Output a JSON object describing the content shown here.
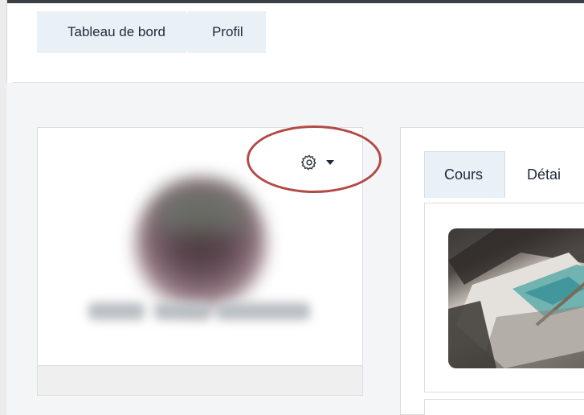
{
  "breadcrumb": {
    "items": [
      {
        "label": "Tableau de bord"
      },
      {
        "label": "Profil"
      }
    ]
  },
  "profile_card": {
    "settings_icon": "gear-icon",
    "dropdown_icon": "caret-down-icon"
  },
  "main": {
    "tabs": [
      {
        "label": "Cours"
      },
      {
        "label": "Détai"
      }
    ]
  },
  "colors": {
    "breadcrumb_bg": "#e9f1f7",
    "highlight": "#b24a47",
    "text": "#1f2a37"
  }
}
